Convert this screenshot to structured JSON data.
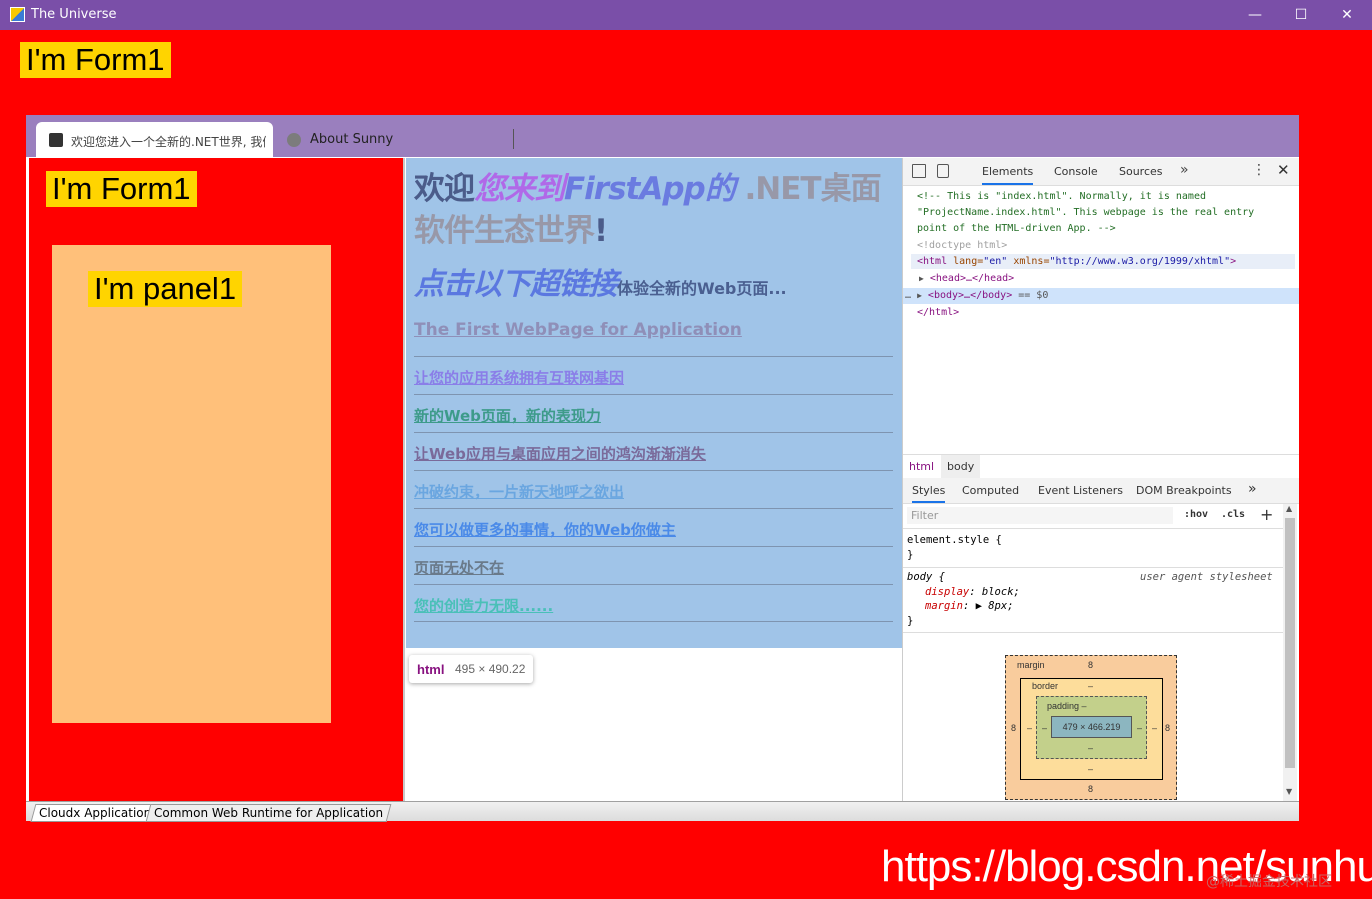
{
  "window": {
    "title": "The Universe",
    "minimize": "—",
    "maximize": "☐",
    "close": "✕"
  },
  "form_label": "I'm Form1",
  "inner_form_label": "I'm Form1",
  "panel_label": "I'm panel1",
  "tabs": [
    {
      "title": "欢迎您进入一个全新的.NET世界, 我们",
      "icon": "app-icon"
    },
    {
      "title": "About Sunny",
      "icon": "globe-icon"
    }
  ],
  "web": {
    "heading_parts": [
      "欢迎",
      "您来到",
      "FirstApp的",
      " .NET桌面软件生态世界",
      "!"
    ],
    "subheading": "点击以下超链接",
    "subheading_small": "体验全新的Web页面...",
    "main_link": "The First WebPage for Application",
    "links": [
      {
        "text": "让您的应用系统拥有互联网基因",
        "color": "#8a7ee8"
      },
      {
        "text": "新的Web页面，新的表现力",
        "color": "#3d9b8a"
      },
      {
        "text": "让Web应用与桌面应用之间的鸿沟渐渐消失",
        "color": "#7a6a9a"
      },
      {
        "text": "冲破约束，一片新天地呼之欲出",
        "color": "#6aa6e0"
      },
      {
        "text": "您可以做更多的事情，你的Web你做主",
        "color": "#4a8ae8"
      },
      {
        "text": "页面无处不在",
        "color": "#6a7a8a"
      },
      {
        "text": "您的创造力无限......",
        "color": "#4ac0b8"
      }
    ]
  },
  "tooltip": {
    "tag": "html",
    "dims": "495 × 490.22"
  },
  "devtools": {
    "tabs": [
      "Elements",
      "Console",
      "Sources"
    ],
    "more": "»",
    "kebab": "⋮",
    "close": "✕",
    "code": {
      "comment1": "<!-- This is \"index.html\". Normally, it is named",
      "comment2": "\"ProjectName.index.html\". This webpage is the real entry",
      "comment3": "point of the HTML-driven App. -->",
      "doctype": "<!doctype html>",
      "html_open_tag": "<html",
      "lang_attr": " lang=",
      "lang_val": "\"en\"",
      "xmlns_attr": " xmlns=",
      "xmlns_val": "\"http://www.w3.org/1999/xhtml\"",
      "close_bracket": ">",
      "head_line": "<head>…</head>",
      "body_line": "<body>…</body>",
      "body_suffix": " == $0",
      "ellipsis": "…",
      "html_close": "</html>"
    },
    "breadcrumbs": [
      "html",
      "body"
    ],
    "subtabs": [
      "Styles",
      "Computed",
      "Event Listeners",
      "DOM Breakpoints"
    ],
    "filter_placeholder": "Filter",
    "hov": ":hov",
    "cls": ".cls",
    "plus": "+",
    "element_style": "element.style {",
    "brace_close": "}",
    "body_selector": "body {",
    "ua_label": "user agent stylesheet",
    "display_prop": "display",
    "display_val": ": block;",
    "margin_prop": "margin",
    "margin_val": ": ▶ 8px;",
    "boxmodel": {
      "margin_label": "margin",
      "margin_top": "8",
      "margin_bottom": "8",
      "margin_left": "8",
      "margin_right": "8",
      "border_label": "border",
      "border_val": "–",
      "padding_label": "padding –",
      "padding_val": "–",
      "content": "479 × 466.219"
    }
  },
  "bottom_tabs": [
    "Cloudx Application",
    "Common Web Runtime for Application"
  ],
  "watermark": "https://blog.csdn.net/sunhui",
  "watermark_sub": "@稀土掘金技术社区"
}
